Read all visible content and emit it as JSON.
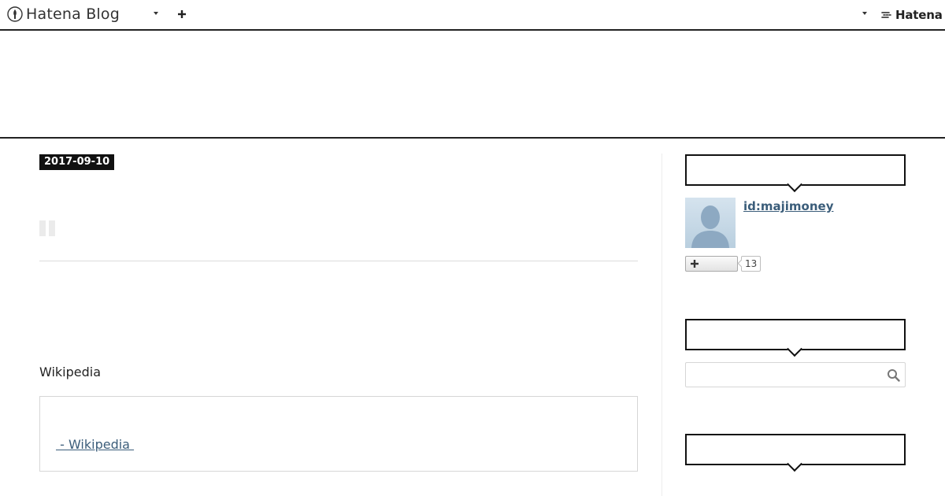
{
  "global_header": {
    "brand": "Hatena Blog",
    "hatena_brand": "Hatena",
    "icons": [
      "hatena-blog-logo-icon",
      "chevron-down-icon",
      "plus-icon",
      "chevron-down-icon",
      "hatena-logo-icon"
    ]
  },
  "entry": {
    "date": "2017-09-10",
    "section_heading": "Wikipedia",
    "embed_link": " - Wikipedia "
  },
  "sidebar": {
    "profile": {
      "user_id": "id:majimoney",
      "follower_count": "13"
    },
    "search": {
      "placeholder": "",
      "value": ""
    }
  },
  "colors": {
    "text": "#222222",
    "link": "#3b5d7a",
    "badge_bg": "#111111",
    "border": "#d6d6d6"
  }
}
